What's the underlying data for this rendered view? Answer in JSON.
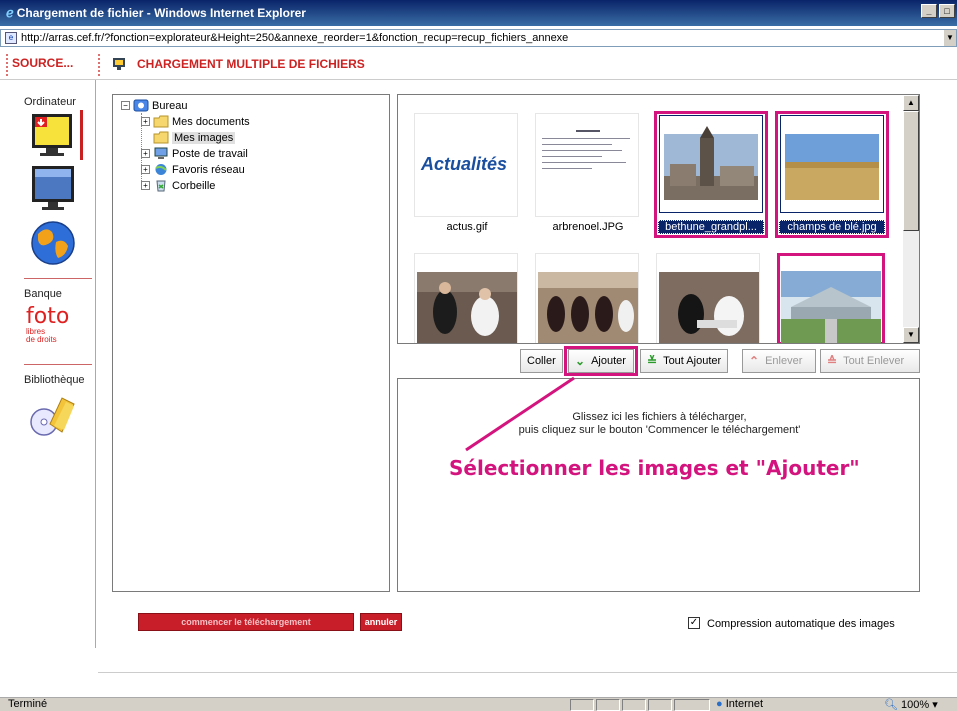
{
  "window": {
    "title": "Chargement de fichier - Windows Internet Explorer"
  },
  "address": {
    "url": "http://arras.cef.fr/?fonction=explorateur&Height=250&annexe_reorder=1&fonction_recup=recup_fichiers_annexe"
  },
  "app": {
    "source_label": "SOURCE...",
    "title": "CHARGEMENT MULTIPLE DE FICHIERS"
  },
  "sidebar": {
    "ordinateur_label": "Ordinateur",
    "banque_label": "Banque",
    "foto_logo_text": "foto",
    "foto_sub1": "libres",
    "foto_sub2": "de droits",
    "bibliotheque_label": "Bibliothèque"
  },
  "tree": {
    "root": "Bureau",
    "items": [
      "Mes documents",
      "Mes images",
      "Poste de travail",
      "Favoris réseau",
      "Corbeille"
    ]
  },
  "thumbnails": [
    {
      "filename": "actus.gif",
      "selected": false,
      "thumb_text": "Actualités"
    },
    {
      "filename": "arbrenoel.JPG",
      "selected": false
    },
    {
      "filename": "bethune_grandpl...",
      "selected": true
    },
    {
      "filename": "champs de blé.jpg",
      "selected": true
    },
    {
      "filename": "",
      "selected": false
    },
    {
      "filename": "",
      "selected": false
    },
    {
      "filename": "",
      "selected": false
    },
    {
      "filename": "",
      "selected": false
    }
  ],
  "toolbar": {
    "coller": "Coller",
    "ajouter": "Ajouter",
    "tout_ajouter": "Tout Ajouter",
    "enlever": "Enlever",
    "tout_enlever": "Tout Enlever"
  },
  "drop_zone": {
    "line1": "Glissez ici les fichiers à télécharger,",
    "line2": "puis cliquez sur le bouton 'Commencer le téléchargement'"
  },
  "annotation": {
    "text": "Sélectionner les images et \"Ajouter\""
  },
  "actions": {
    "start_label": "commencer le téléchargement",
    "cancel_label": "annuler",
    "compression_label": "Compression automatique des images",
    "compression_checked": true
  },
  "statusbar": {
    "text": "Terminé",
    "zone": "Internet",
    "zoom": "100%"
  },
  "colors": {
    "accent": "#d4147e",
    "brand_red": "#c81e2a"
  }
}
